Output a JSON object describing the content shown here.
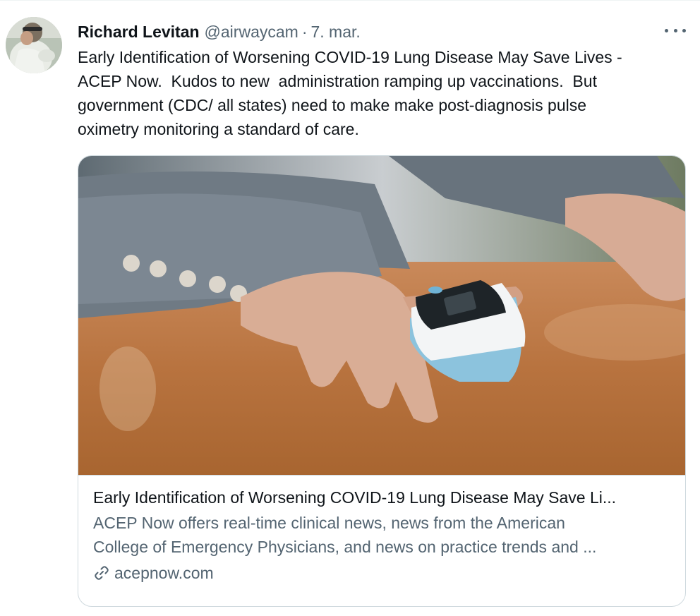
{
  "tweet": {
    "author": {
      "display_name": "Richard Levitan",
      "handle": "@airwaycam"
    },
    "separator": "·",
    "timestamp": "7. mar.",
    "text": "Early Identification of Worsening COVID-19 Lung Disease May Save Lives -\nACEP Now.  Kudos to new  administration ramping up vaccinations.  But\ngovernment (CDC/ all states) need to make make post-diagnosis pulse\noximetry monitoring a standard of care.",
    "more_icon": "more-horizontal-icon"
  },
  "card": {
    "image_subject": "pulse oximeter on finger",
    "title": "Early Identification of Worsening COVID-19 Lung Disease May Save Li...",
    "description": "ACEP Now offers real-time clinical news, news from the American\nCollege of Emergency Physicians, and news on practice trends and ...",
    "domain": "acepnow.com",
    "domain_icon": "link-icon"
  },
  "colors": {
    "text_primary": "#0f1419",
    "text_secondary": "#536471",
    "border": "#cfd9de"
  }
}
